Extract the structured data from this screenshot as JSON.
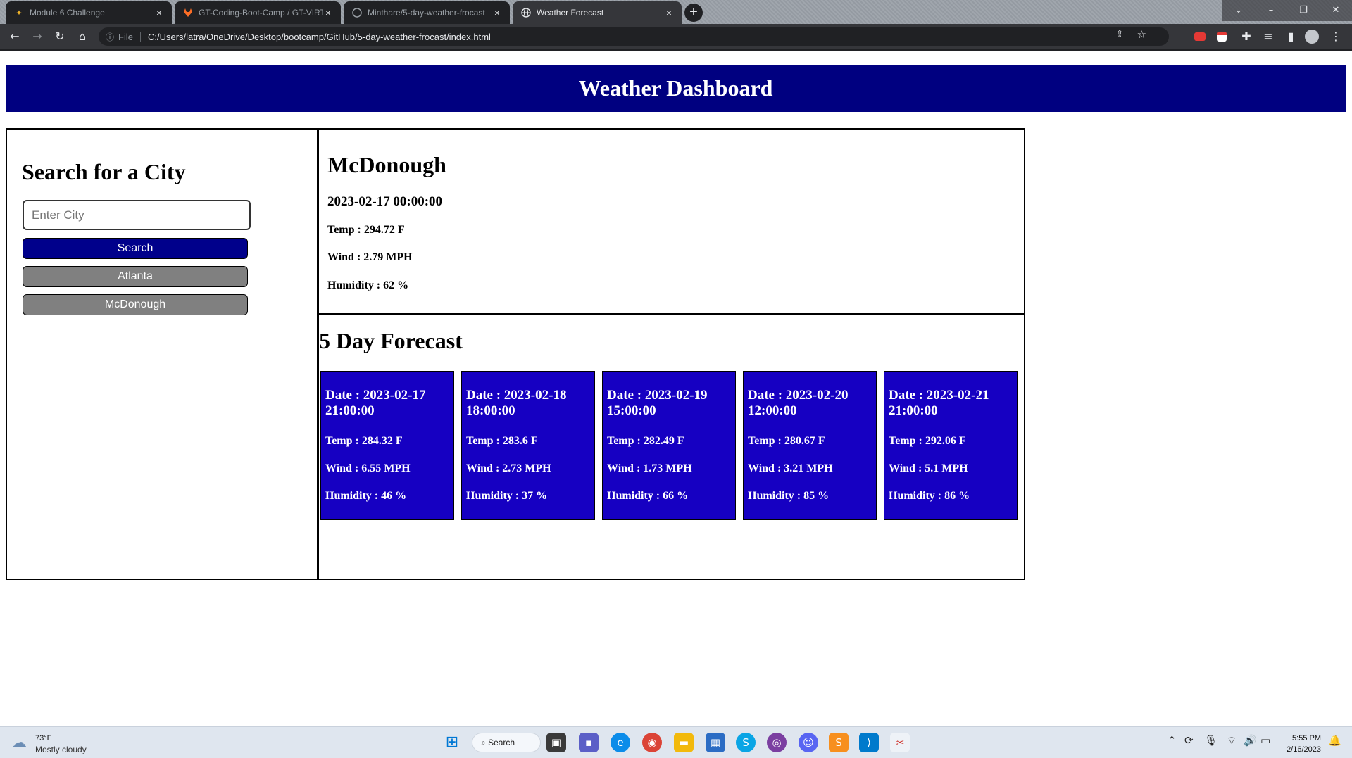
{
  "browser": {
    "tabs": [
      {
        "label": "Module 6 Challenge",
        "icon": "star-icon",
        "active": false
      },
      {
        "label": "GT-Coding-Boot-Camp / GT-VIRT",
        "icon": "gitlab-icon",
        "active": false
      },
      {
        "label": "Minthare/5-day-weather-frocast",
        "icon": "github-icon",
        "active": false
      },
      {
        "label": "Weather Forecast",
        "icon": "globe-icon",
        "active": true
      }
    ],
    "address_scheme": "File",
    "address_url": "C:/Users/latra/OneDrive/Desktop/bootcamp/GitHub/5-day-weather-frocast/index.html"
  },
  "page": {
    "title": "Weather Dashboard",
    "search": {
      "heading": "Search for a City",
      "placeholder": "Enter City",
      "button_label": "Search",
      "history": [
        "Atlanta",
        "McDonough"
      ]
    },
    "current": {
      "city": "McDonough",
      "date": "2023-02-17 00:00:00",
      "temp": "Temp : 294.72 F",
      "wind": "Wind : 2.79 MPH",
      "humidity": "Humidity : 62 %"
    },
    "forecast_title": "5 Day Forecast",
    "forecast": [
      {
        "date": "Date : 2023-02-17 21:00:00",
        "temp": "Temp : 284.32 F",
        "wind": "Wind : 6.55 MPH",
        "humidity": "Humidity : 46 %"
      },
      {
        "date": "Date : 2023-02-18 18:00:00",
        "temp": "Temp : 283.6 F",
        "wind": "Wind : 2.73 MPH",
        "humidity": "Humidity : 37 %"
      },
      {
        "date": "Date : 2023-02-19 15:00:00",
        "temp": "Temp : 282.49 F",
        "wind": "Wind : 1.73 MPH",
        "humidity": "Humidity : 66 %"
      },
      {
        "date": "Date : 2023-02-20 12:00:00",
        "temp": "Temp : 280.67 F",
        "wind": "Wind : 3.21 MPH",
        "humidity": "Humidity : 85 %"
      },
      {
        "date": "Date : 2023-02-21 21:00:00",
        "temp": "Temp : 292.06 F",
        "wind": "Wind : 5.1 MPH",
        "humidity": "Humidity : 86 %"
      }
    ]
  },
  "colors": {
    "header_bg": "#000080",
    "search_button": "#00008b",
    "history_button": "#808080",
    "card_bg": "#1600c2"
  },
  "taskbar": {
    "weather_temp": "73°F",
    "weather_desc": "Mostly cloudy",
    "search_label": "Search",
    "time": "5:55 PM",
    "date": "2/16/2023"
  }
}
